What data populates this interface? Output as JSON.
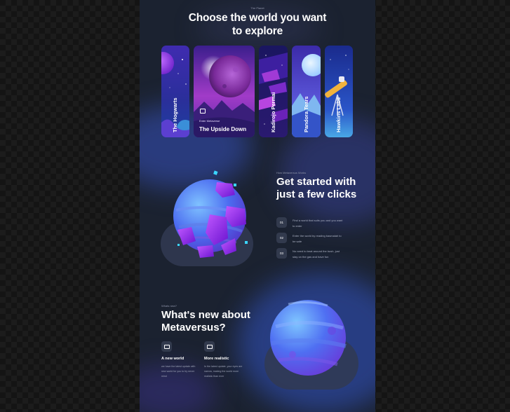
{
  "hero": {
    "eyebrow": "The Planet",
    "title": "Choose the world you want to explore"
  },
  "worlds": {
    "cards": [
      {
        "label": "The Hogwarts"
      },
      {
        "label": "The Upside Down",
        "enter": "Enter Metaverse"
      },
      {
        "label": "Kadirojo Permai"
      },
      {
        "label": "Pandora Tears"
      },
      {
        "label": "Hawkins Labs"
      }
    ]
  },
  "get_started": {
    "eyebrow": "How Metaversus Works",
    "title": "Get started with just a few clicks",
    "steps": [
      {
        "num": "01",
        "text": "Find a world that suits you and you want to enter"
      },
      {
        "num": "02",
        "text": "Enter the world by reading basmalah to be safe"
      },
      {
        "num": "03",
        "text": "No need to beat around the bush, just stay on the gas and have fun"
      }
    ]
  },
  "whats_new": {
    "eyebrow": "Whats new?",
    "title": "What's new about Metaversus?",
    "features": [
      {
        "title": "A new world",
        "desc": "we have the latest update with new world for you to try never mind",
        "icon": "vr-headset-icon"
      },
      {
        "title": "More realistic",
        "desc": "In the latest update, your eyes are narrow, making the world more realistic than ever",
        "icon": "vr-headset-icon"
      }
    ]
  },
  "colors": {
    "page_bg": "#1b2230",
    "step_box": "#323a4d",
    "planet_blue": "#4a6ff0",
    "planet_purple": "#8b2fe0"
  }
}
